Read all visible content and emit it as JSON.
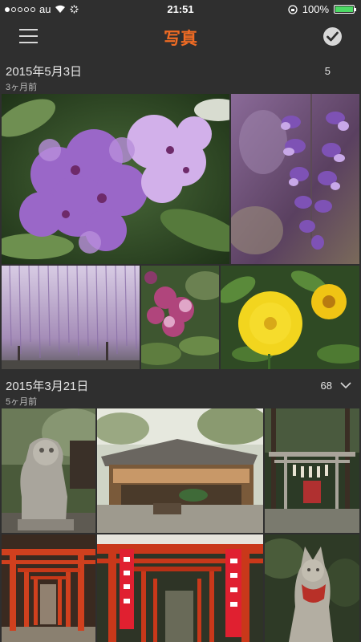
{
  "status_bar": {
    "carrier": "au",
    "time": "21:51",
    "battery": "100%"
  },
  "nav": {
    "title": "写真"
  },
  "sections": [
    {
      "date": "2015年5月3日",
      "ago": "3ヶ月前",
      "count": "5",
      "photos": [
        {
          "subject": "pink rhododendron flowers"
        },
        {
          "subject": "purple wisteria close-up"
        },
        {
          "subject": "wisteria trellis"
        },
        {
          "subject": "pink flower with leaves"
        },
        {
          "subject": "yellow flowers"
        }
      ]
    },
    {
      "date": "2015年3月21日",
      "ago": "5ヶ月前",
      "count": "68",
      "photos": [
        {
          "subject": "stone komainu guardian statue"
        },
        {
          "subject": "wooden shrine building"
        },
        {
          "subject": "torii gate with shimenawa"
        },
        {
          "subject": "red torii gate tunnel"
        },
        {
          "subject": "red torii gates with banners"
        },
        {
          "subject": "stone fox statue"
        }
      ]
    }
  ],
  "colors": {
    "accent": "#ef6b24",
    "background": "#2f2f2f",
    "battery": "#4cd964"
  }
}
